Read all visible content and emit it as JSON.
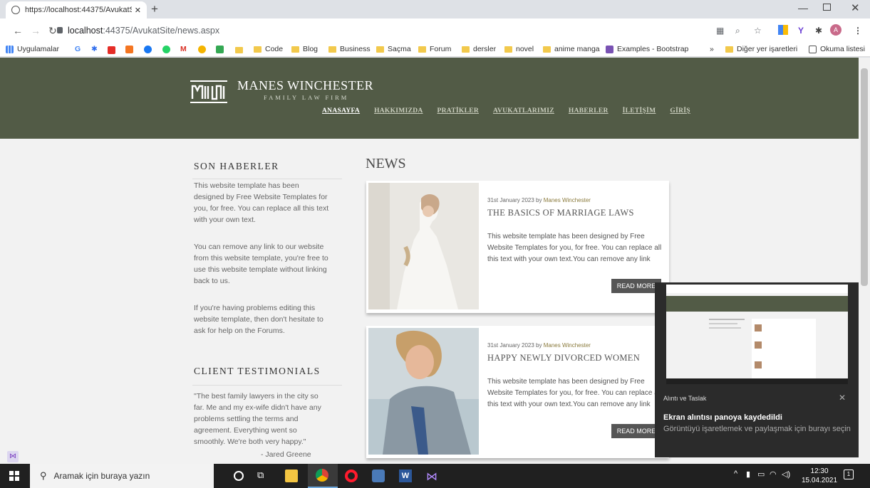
{
  "browser": {
    "tab_title": "https://localhost:44375/AvukatSi",
    "url_host": "localhost",
    "url_path": ":44375/AvukatSite/news.aspx",
    "bookmarks": [
      "Uygulamalar",
      "Code",
      "Blog",
      "Business",
      "Saçma",
      "Forum",
      "dersler",
      "novel",
      "anime manga",
      "Examples - Bootstrap"
    ],
    "bookmarks_right": [
      "Diğer yer işaretleri",
      "Okuma listesi"
    ],
    "ext_badge": "A",
    "more_bm": "»"
  },
  "site": {
    "brand": "MANES WINCHESTER",
    "tagline": "FAMILY LAW FIRM",
    "menu": [
      "ANASAYFA",
      "HAKKIMIZDA",
      "PRATİKLER",
      "AVUKATLARIMIZ",
      "HABERLER",
      "İLETİŞİM",
      "GİRİŞ"
    ]
  },
  "sidebar": {
    "news_heading": "SON HABERLER",
    "news_p1": "This website template has been designed by Free Website Templates for you, for free. You can replace all this text with your own text.",
    "news_p2": "You can remove any link to our website from this website template, you're free to use this website template without linking back to us.",
    "news_p3": "If you're having problems editing this website template, then don't hesitate to ask for help on the Forums.",
    "testimonials_heading": "CLIENT TESTIMONIALS",
    "testimonial": "\"The best family lawyers in the city so far. Me and my ex-wife didn't have any problems settling the terms and agreement. Everything went so smoothly. We're both very happy.\"",
    "testimonial_author": "- Jared Greene"
  },
  "news": {
    "heading": "NEWS",
    "items": [
      {
        "date": "31st January 2023 by ",
        "author": "Manes Winchester",
        "title": "THE BASICS OF MARRIAGE LAWS",
        "body": "This website template has been designed by Free Website Templates for you, for free. You can replace all this text with your own text.You can remove any link",
        "read_more": "READ MORE"
      },
      {
        "date": "31st January 2023 by ",
        "author": "Manes Winchester",
        "title": "HAPPY NEWLY DIVORCED WOMEN",
        "body": "This website template has been designed by Free Website Templates for you, for free. You can replace all this text with your own text.You can remove any link",
        "read_more": "READ MORE"
      }
    ]
  },
  "toast": {
    "app": "Alıntı ve Taslak",
    "title": "Ekran alıntısı panoya kaydedildi",
    "body": "Görüntüyü işaretlemek ve paylaşmak için burayı seçin"
  },
  "taskbar": {
    "search_placeholder": "Aramak için buraya yazın",
    "time": "12:30",
    "date": "15.04.2021",
    "notif_count": "1"
  }
}
